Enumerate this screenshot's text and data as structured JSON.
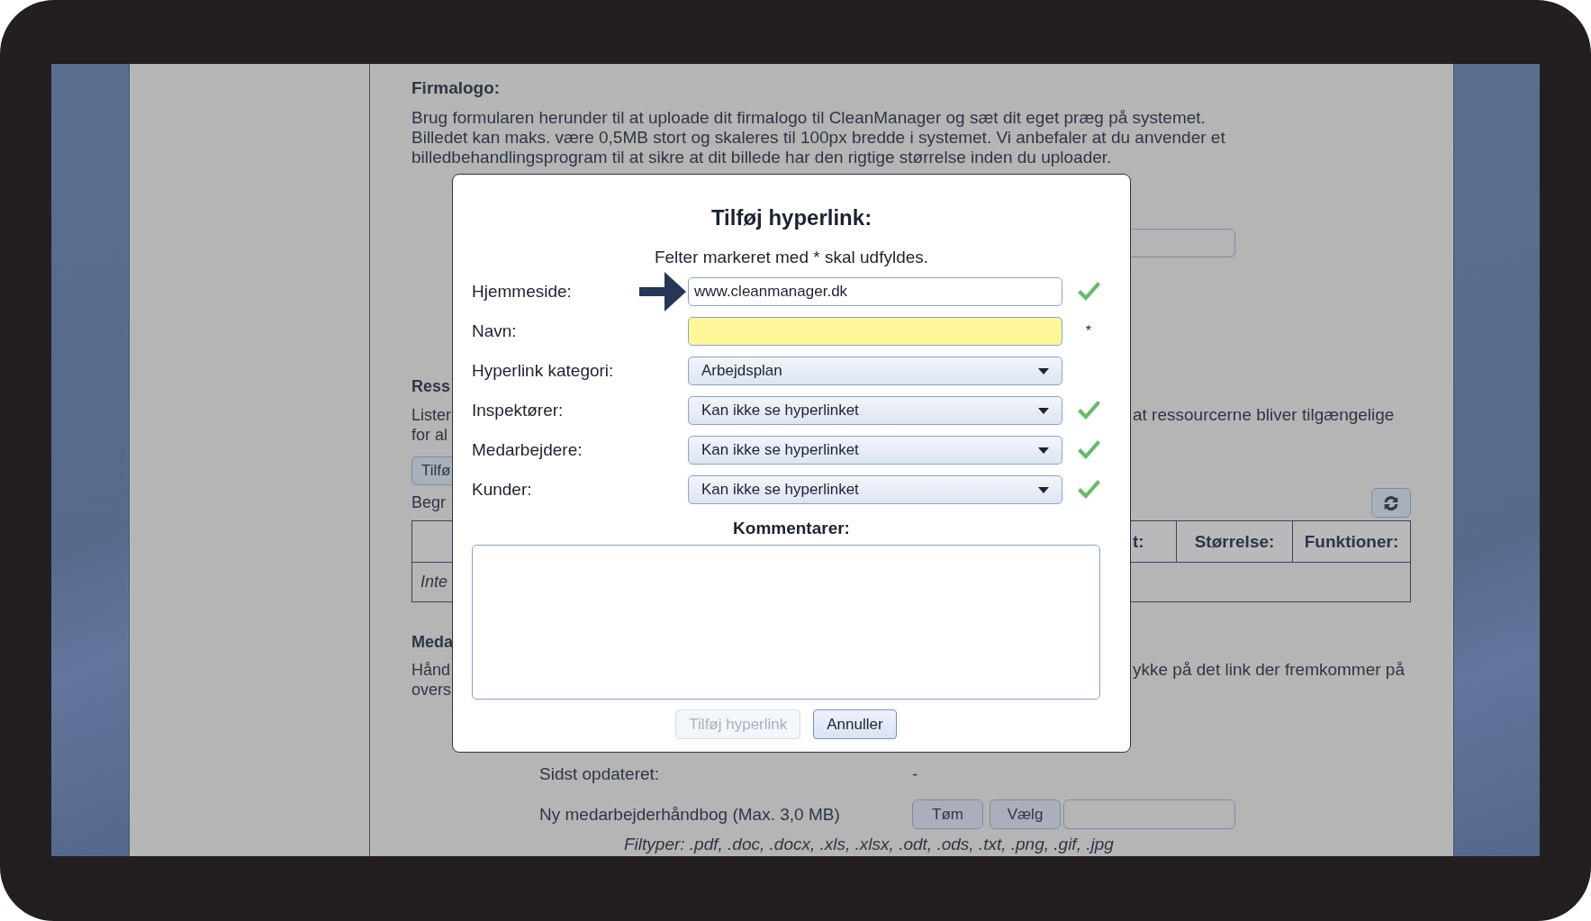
{
  "background_page": {
    "heading": "Firmalogo:",
    "paragraph_lines": [
      "Brug formularen herunder til at uploade dit firmalogo til CleanManager og sæt dit eget præg på systemet.",
      "Billedet kan maks. være 0,5MB stort og skaleres til 100px bredde i systemet. Vi anbefaler at du anvender et",
      "billedbehandlingsprogram til at sikre at dit billede har den rigtige størrelse inden du uploader."
    ],
    "left_column": [
      {
        "kind": "heading",
        "text": "Ress"
      },
      {
        "kind": "text",
        "lines": [
          "Lister",
          "for al"
        ]
      },
      {
        "kind": "button",
        "text": "Tilfø"
      },
      {
        "kind": "text",
        "lines": [
          "Begr"
        ]
      },
      {
        "kind": "table",
        "cell": "Inte"
      },
      {
        "kind": "heading",
        "text": "Meda"
      },
      {
        "kind": "text",
        "lines": [
          "Hånd",
          "overs"
        ]
      }
    ],
    "right_column": [
      {
        "kind": "field"
      },
      {
        "kind": "text",
        "lines": [
          "at ressourcerne bliver tilgængelige"
        ]
      },
      {
        "kind": "refresh"
      },
      {
        "kind": "table",
        "headers": [
          "t:",
          "Størrelse:",
          "Funktioner:"
        ]
      },
      {
        "kind": "text",
        "lines": [
          "ykke på det link der fremkommer på"
        ]
      }
    ],
    "updated": {
      "label": "Sidst opdateret:",
      "value": "-"
    },
    "upload": {
      "label": "Ny medarbejderhåndbog (Max. 3,0 MB)",
      "buttons": [
        "Tøm",
        "Vælg"
      ]
    },
    "file_types": "Filtyper: .pdf, .doc, .docx, .xls, .xlsx, .odt, .ods, .txt, .png, .gif, .jpg"
  },
  "dialog": {
    "title": "Tilføj hyperlink:",
    "note": "Felter markeret med * skal udfyldes.",
    "fields": [
      {
        "label": "Hjemmeside:",
        "kind": "text",
        "value": "www.cleanmanager.dk",
        "valid": true,
        "highlighted": false,
        "pointed": true
      },
      {
        "label": "Navn:",
        "kind": "text",
        "valid": false,
        "highlighted": true,
        "pointed": false,
        "marker": "*"
      },
      {
        "label": "Hyperlink kategori:",
        "kind": "select",
        "value": "Arbejdsplan",
        "valid": false,
        "highlighted": false,
        "pointed": false
      },
      {
        "label": "Inspektører:",
        "kind": "select",
        "value": "Kan ikke se hyperlinket",
        "valid": true,
        "highlighted": false,
        "pointed": false
      },
      {
        "label": "Medarbejdere:",
        "kind": "select",
        "value": "Kan ikke se hyperlinket",
        "valid": true,
        "highlighted": false,
        "pointed": false
      },
      {
        "label": "Kunder:",
        "kind": "select",
        "value": "Kan ikke se hyperlinket",
        "valid": true,
        "highlighted": false,
        "pointed": false
      }
    ],
    "comments_label": "Kommentarer:",
    "buttons": [
      {
        "label": "Tilføj hyperlink",
        "disabled": true
      },
      {
        "label": "Annuller",
        "disabled": false
      }
    ]
  }
}
